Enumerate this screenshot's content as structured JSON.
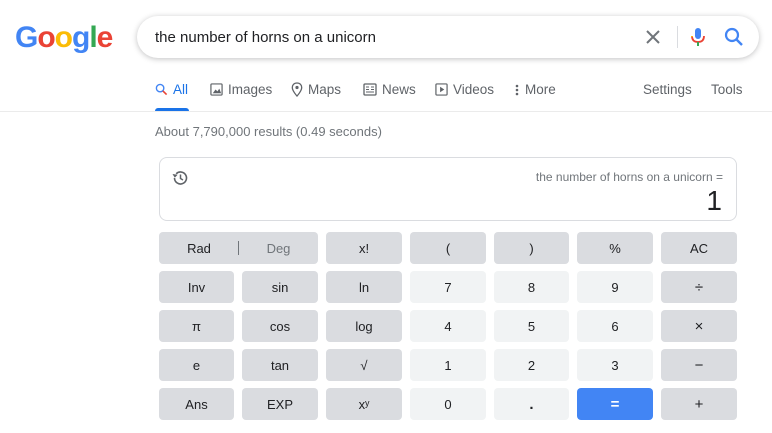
{
  "logo": {
    "letters": [
      "G",
      "o",
      "o",
      "g",
      "l",
      "e"
    ],
    "colors": [
      "#4285f4",
      "#ea4335",
      "#fbbc05",
      "#4285f4",
      "#34a853",
      "#ea4335"
    ]
  },
  "search": {
    "query": "the number of horns on a unicorn"
  },
  "tabs": [
    {
      "label": "All",
      "icon": "search-icon",
      "active": true
    },
    {
      "label": "Images",
      "icon": "image-icon"
    },
    {
      "label": "Maps",
      "icon": "map-pin-icon"
    },
    {
      "label": "News",
      "icon": "newspaper-icon"
    },
    {
      "label": "Videos",
      "icon": "play-icon"
    },
    {
      "label": "More",
      "icon": "more-vert-icon"
    }
  ],
  "tools": {
    "settings": "Settings",
    "tools": "Tools"
  },
  "result_stats": "About 7,790,000 results (0.49 seconds)",
  "calculator": {
    "expression": "the number of horns on a unicorn =",
    "result": "1",
    "keys": {
      "rad": "Rad",
      "deg": "Deg",
      "fact": "x!",
      "lparen": "(",
      "rparen": ")",
      "percent": "%",
      "ac": "AC",
      "inv": "Inv",
      "sin": "sin",
      "ln": "ln",
      "seven": "7",
      "eight": "8",
      "nine": "9",
      "divide": "÷",
      "pi": "π",
      "cos": "cos",
      "log": "log",
      "four": "4",
      "five": "5",
      "six": "6",
      "multiply": "×",
      "e": "e",
      "tan": "tan",
      "sqrt": "√",
      "one": "1",
      "two": "2",
      "three": "3",
      "minus": "−",
      "ans": "Ans",
      "exp": "EXP",
      "pow": "xʸ",
      "zero": "0",
      "dot": ".",
      "equals": "=",
      "plus": "+"
    }
  },
  "colors": {
    "accent": "#1a73e8",
    "equals_key": "#4285f4",
    "function_key": "#dadce0",
    "number_key": "#f1f3f4"
  }
}
